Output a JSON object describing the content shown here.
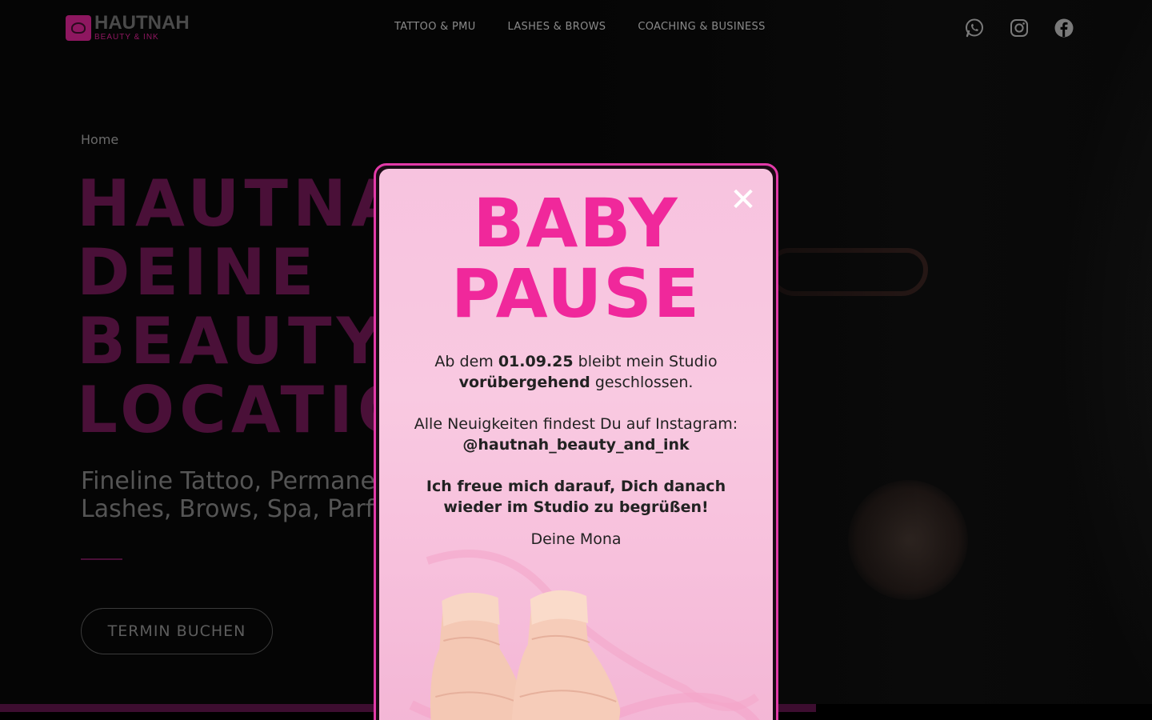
{
  "nav": {
    "logo_title": "HAUTNAH",
    "logo_subtitle": "BEAUTY & INK",
    "links": [
      "TATTOO & PMU",
      "LASHES & BROWS",
      "COACHING & BUSINESS"
    ],
    "social_icons": [
      "whatsapp-icon",
      "instagram-icon",
      "facebook-icon"
    ]
  },
  "hero": {
    "breadcrumb": "Home",
    "title_lines": [
      "HAUTNA",
      "DEINE",
      "BEAUTY",
      "LOCATIO"
    ],
    "subtitle_lines": [
      "Fineline Tattoo, Permane",
      "Lashes, Brows, Spa, Parf"
    ],
    "cta_label": "TERMIN BUCHEN"
  },
  "popup": {
    "close_symbol": "✕",
    "headline_lines": [
      "BABY",
      "PAUSE"
    ],
    "p1_prefix": "Ab dem ",
    "p1_date": "01.09.25",
    "p1_suffix": " bleibt mein Studio",
    "p1_bold_word": "vorübergehend",
    "p1_end": " geschlossen.",
    "p2_line1": "Alle Neuigkeiten findest Du auf Instagram:",
    "p2_handle": "@hautnah_beauty_and_ink",
    "p3_line1": "Ich freue mich darauf, Dich danach",
    "p3_line2": "wieder im Studio zu begrüßen!",
    "signature": "Deine Mona"
  },
  "colors": {
    "accent": "#f0289b",
    "brand_dark": "#4a1038",
    "popup_bg": "#f7c3df",
    "popup_border": "#e23aa8"
  }
}
